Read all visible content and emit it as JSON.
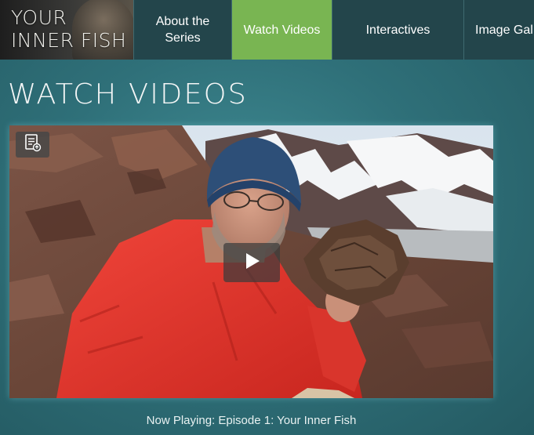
{
  "logo": {
    "line1": "YOUR",
    "line2": "INNER FISH"
  },
  "nav": {
    "about": "About the\nSeries",
    "watch": "Watch Videos",
    "interactives": "Interactives",
    "gallery": "Image Gal"
  },
  "page": {
    "title": "WATCH VIDEOS"
  },
  "player": {
    "now_playing": "Now Playing: Episode 1: Your Inner Fish"
  },
  "colors": {
    "nav_active": "#79b552",
    "nav_bg": "#23454b",
    "page_bg": "#2f7079",
    "jacket": "#e0322a",
    "beanie": "#2d4f78"
  },
  "icons": {
    "transcript": "transcript-icon",
    "play": "play-icon"
  }
}
